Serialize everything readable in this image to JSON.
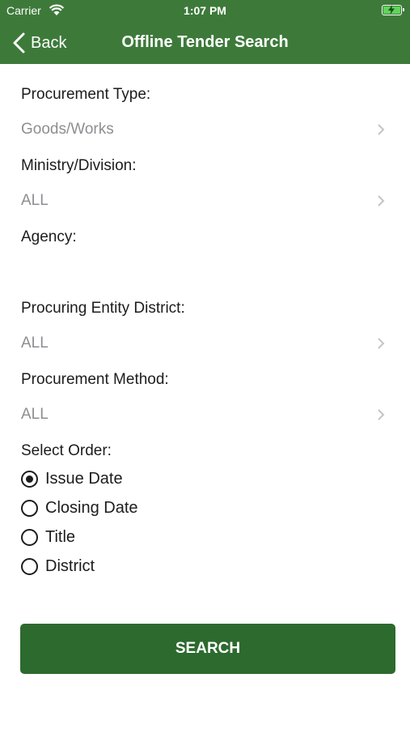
{
  "status_bar": {
    "carrier": "Carrier",
    "time": "1:07 PM"
  },
  "nav": {
    "back_label": "Back",
    "title": "Offline Tender Search"
  },
  "form": {
    "procurement_type": {
      "label": "Procurement Type:",
      "value": "Goods/Works"
    },
    "ministry": {
      "label": "Ministry/Division:",
      "value": "ALL"
    },
    "agency": {
      "label": "Agency:",
      "value": ""
    },
    "district": {
      "label": "Procuring Entity District:",
      "value": "ALL"
    },
    "method": {
      "label": "Procurement Method:",
      "value": "ALL"
    },
    "order": {
      "label": "Select Order:",
      "options": [
        "Issue Date",
        "Closing Date",
        "Title",
        "District"
      ],
      "selected": "Issue Date"
    }
  },
  "search_button": {
    "label": "SEARCH"
  },
  "colors": {
    "header": "#3d7a3a",
    "button": "#2d6a2e"
  }
}
